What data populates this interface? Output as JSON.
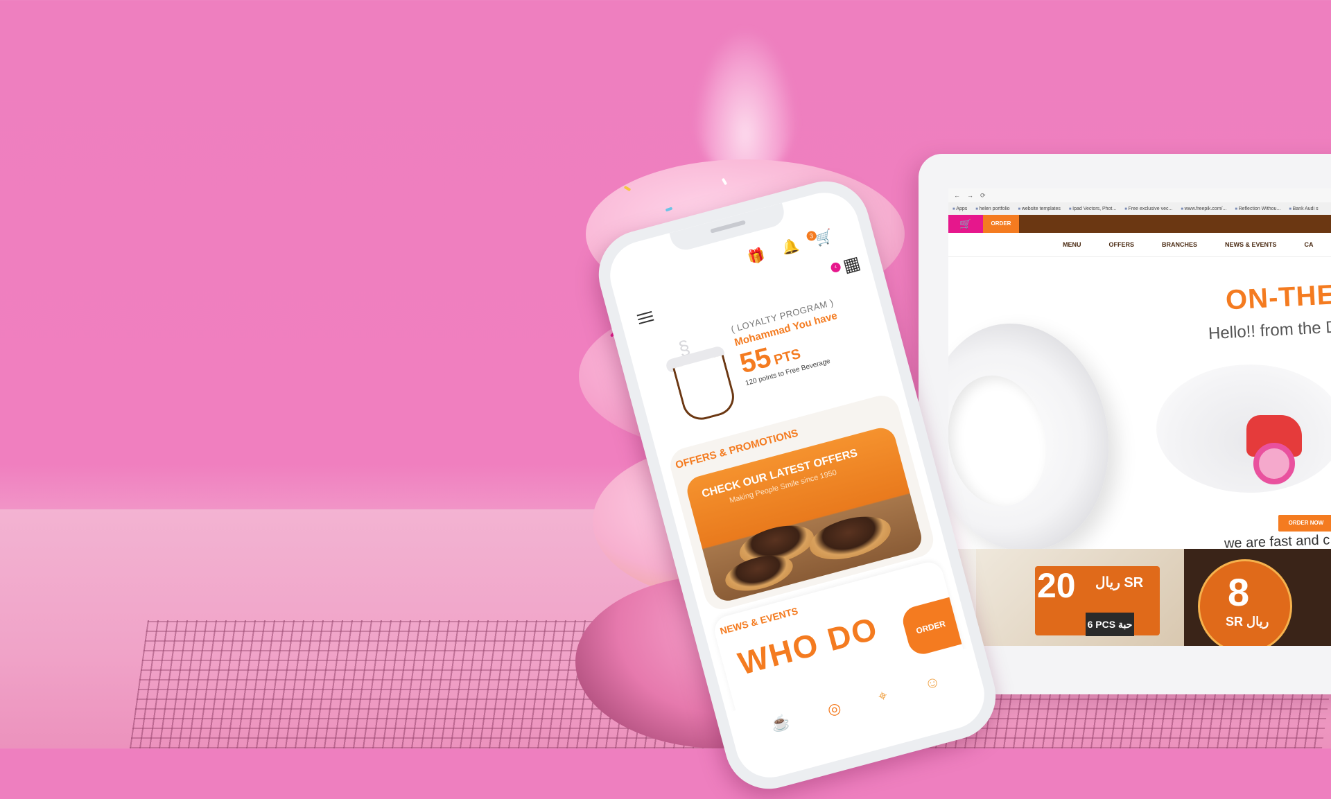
{
  "tablet": {
    "browser_nav": [
      "←",
      "→",
      "⟳"
    ],
    "bookmarks": [
      "Apps",
      "helen portfolio",
      "website templates",
      "Ipad Vectors, Phot...",
      "Free exclusive vec...",
      "www.freepik.com/...",
      "Reflection Withou...",
      "Bank Audi s"
    ],
    "cart_icon": "cart-icon",
    "order_label": "ORDER",
    "nav": [
      "MENU",
      "OFFERS",
      "BRANCHES",
      "NEWS & EVENTS",
      "CA"
    ],
    "hero_title": "ON-THE-",
    "hero_subtitle": "Hello!! from the De",
    "order_now": "ORDER NOW",
    "hero_tagline": "we are fast and c",
    "promo": {
      "price1": "20",
      "currency1": "ريال SR",
      "pcs": "6 PCS حبة",
      "price2": "8",
      "currency2": "SR ريال"
    }
  },
  "phone": {
    "top_icons": [
      "gift-icon",
      "bell-icon",
      "cart-icon"
    ],
    "cart_badge": "3",
    "menu_icon": "menu-icon",
    "qr_icon": "qr-code-icon",
    "loyalty_label": "( LOYALTY PROGRAM )",
    "loyalty_name": "Mohammad You have",
    "points_value": "55",
    "points_unit": "PTS",
    "points_note": "120 points to Free Beverage",
    "offers_title": "OFFERS & PROMOTIONS",
    "offer_headline": "CHECK OUR LATEST OFFERS",
    "offer_subline": "Making People Smile since 1950",
    "news_title": "NEWS & EVENTS",
    "news_art_text": "WHO DO",
    "order_button": "ORDER",
    "tabs": [
      "cup-icon",
      "donut-icon",
      "location-icon",
      "profile-icon"
    ]
  }
}
